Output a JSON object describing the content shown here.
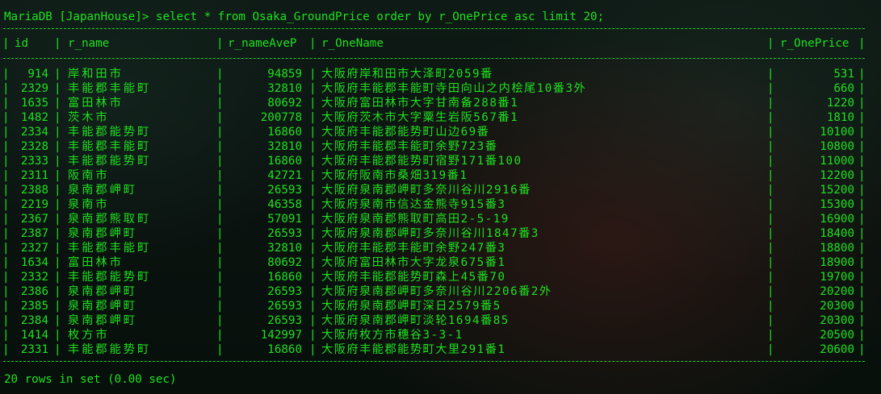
{
  "prompt": {
    "text": "MariaDB [JapanHouse]> select * from Osaka_GroundPrice order by r_OnePrice asc limit 20;"
  },
  "table": {
    "columns": [
      "id",
      "r_name",
      "r_nameAveP",
      "r_OneName",
      "r_OnePrice"
    ],
    "rows": [
      [
        "914",
        "岸和田市",
        "94859",
        "大阪府岸和田市大泽町2059番",
        "531"
      ],
      [
        "2329",
        "丰能郡丰能町",
        "32810",
        "大阪府丰能郡丰能町寺田向山之内桧尾10番3外",
        "660"
      ],
      [
        "1635",
        "富田林市",
        "80692",
        "大阪府富田林市大字甘南备288番1",
        "1220"
      ],
      [
        "1482",
        "茨木市",
        "200778",
        "大阪府茨木市大字粟生岩阪567番1",
        "1810"
      ],
      [
        "2334",
        "丰能郡能势町",
        "16860",
        "大阪府丰能郡能势町山边69番",
        "10100"
      ],
      [
        "2328",
        "丰能郡丰能町",
        "32810",
        "大阪府丰能郡丰能町余野723番",
        "10800"
      ],
      [
        "2333",
        "丰能郡能势町",
        "16860",
        "大阪府丰能郡能势町宿野171番100",
        "11000"
      ],
      [
        "2311",
        "阪南市",
        "42721",
        "大阪府阪南市桑畑319番1",
        "12200"
      ],
      [
        "2388",
        "泉南郡岬町",
        "26593",
        "大阪府泉南郡岬町多奈川谷川2916番",
        "15200"
      ],
      [
        "2219",
        "泉南市",
        "46358",
        "大阪府泉南市信达金熊寺915番3",
        "15300"
      ],
      [
        "2367",
        "泉南郡熊取町",
        "57091",
        "大阪府泉南郡熊取町高田2-5-19",
        "16900"
      ],
      [
        "2387",
        "泉南郡岬町",
        "26593",
        "大阪府泉南郡岬町多奈川谷川1847番3",
        "18400"
      ],
      [
        "2327",
        "丰能郡丰能町",
        "32810",
        "大阪府丰能郡丰能町余野247番3",
        "18800"
      ],
      [
        "1634",
        "富田林市",
        "80692",
        "大阪府富田林市大字龙泉675番1",
        "18900"
      ],
      [
        "2332",
        "丰能郡能势町",
        "16860",
        "大阪府丰能郡能势町森上45番70",
        "19700"
      ],
      [
        "2386",
        "泉南郡岬町",
        "26593",
        "大阪府泉南郡岬町多奈川谷川2206番2外",
        "20200"
      ],
      [
        "2385",
        "泉南郡岬町",
        "26593",
        "大阪府泉南郡岬町深日2579番5",
        "20300"
      ],
      [
        "2384",
        "泉南郡岬町",
        "26593",
        "大阪府泉南郡岬町淡轮1694番85",
        "20300"
      ],
      [
        "1414",
        "枚方市",
        "142997",
        "大阪府枚方市穗谷3-3-1",
        "20500"
      ],
      [
        "2331",
        "丰能郡能势町",
        "16860",
        "大阪府丰能郡能势町大里291番1",
        "20600"
      ]
    ]
  },
  "footer": {
    "text": "20 rows in set (0.00 sec)"
  },
  "colors": {
    "text": "#1fe01f",
    "background": "#0b1410"
  }
}
